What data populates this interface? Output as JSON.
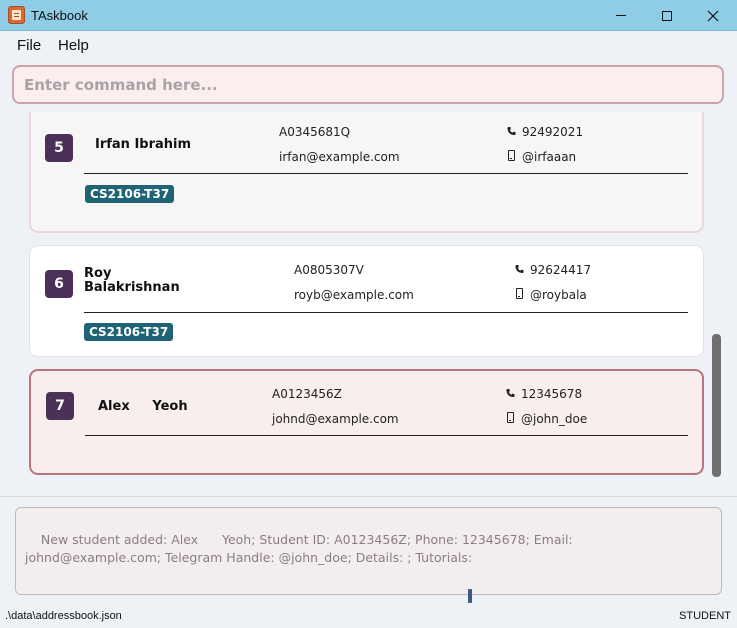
{
  "window": {
    "title": "TAskbook",
    "icon": "addressbook-app-icon"
  },
  "menu": {
    "file": "File",
    "help": "Help"
  },
  "command": {
    "placeholder": "Enter command here...",
    "value": ""
  },
  "students": [
    {
      "index": "5",
      "name": "Irfan Ibrahim",
      "student_id": "A0345681Q",
      "email": "irfan@example.com",
      "phone": "92492021",
      "telegram": "@irfaaan",
      "tag": "CS2106-T37"
    },
    {
      "index": "6",
      "name": "Roy Balakrishnan",
      "student_id": "A0805307V",
      "email": "royb@example.com",
      "phone": "92624417",
      "telegram": "@roybala",
      "tag": "CS2106-T37"
    },
    {
      "index": "7",
      "name": "Alex     Yeoh",
      "student_id": "A0123456Z",
      "email": "johnd@example.com",
      "phone": "12345678",
      "telegram": "@john_doe",
      "tag": ""
    }
  ],
  "result": {
    "message": "New student added: Alex      Yeoh; Student ID: A0123456Z; Phone: 12345678; Email: johnd@example.com; Telegram Handle: @john_doe; Details: ; Tutorials: "
  },
  "status": {
    "file_path": ".\\data\\addressbook.json",
    "mode": "STUDENT"
  },
  "colors": {
    "title_bar": "#8fcde6",
    "index_badge": "#4b3057",
    "tag": "#1f6475",
    "selected_border": "#b8757c"
  }
}
